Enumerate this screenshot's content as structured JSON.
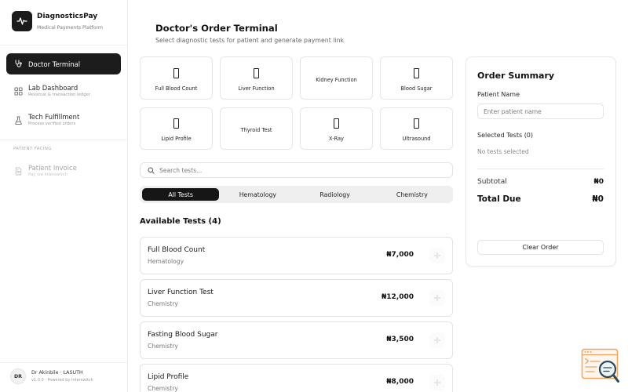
{
  "app": {
    "name": "DiagnosticsPay",
    "tagline": "Medical Payments Platform",
    "logo_icon": "pulse-icon"
  },
  "sidebar": {
    "items": [
      {
        "label": "Doctor Terminal",
        "icon": "stethoscope-icon",
        "active": true
      },
      {
        "label": "Lab Dashboard",
        "subtitle": "Revenue & transaction ledger",
        "icon": "grid-icon",
        "active": false
      },
      {
        "label": "Tech Fulfillment",
        "subtitle": "Process verified orders",
        "icon": "flask-icon",
        "active": false
      }
    ],
    "section_label": "PATIENT FACING",
    "patient_items": [
      {
        "label": "Patient Invoice",
        "subtitle": "Pay via Interswitch",
        "icon": "document-icon",
        "disabled": true
      }
    ],
    "user": {
      "initials": "DR",
      "name": "Dr Akinbile · LASUTH",
      "version": "v1.0.0 · Powered by Interswitch"
    }
  },
  "page": {
    "title": "Doctor's Order Terminal",
    "subtitle": "Select diagnostic tests for patient and generate payment link"
  },
  "quick_tests": [
    {
      "label": "Full Blood Count",
      "has_icon": true
    },
    {
      "label": "Liver Function",
      "has_icon": true
    },
    {
      "label": "Kidney Function",
      "has_icon": false
    },
    {
      "label": "Blood Sugar",
      "has_icon": true
    },
    {
      "label": "Lipid Profile",
      "has_icon": true
    },
    {
      "label": "Thyroid Test",
      "has_icon": false
    },
    {
      "label": "X-Ray",
      "has_icon": true
    },
    {
      "label": "Ultrasound",
      "has_icon": true
    }
  ],
  "search": {
    "placeholder": "Search tests...",
    "value": "",
    "icon": "search-icon"
  },
  "filters": {
    "tabs": [
      "All Tests",
      "Hematology",
      "Radiology",
      "Chemistry"
    ],
    "active_index": 0
  },
  "available": {
    "heading": "Available Tests (4)",
    "tests": [
      {
        "name": "Full Blood Count",
        "category": "Hematology",
        "price": "₦7,000"
      },
      {
        "name": "Liver Function Test",
        "category": "Chemistry",
        "price": "₦12,000"
      },
      {
        "name": "Fasting Blood Sugar",
        "category": "Chemistry",
        "price": "₦3,500"
      },
      {
        "name": "Lipid Profile",
        "category": "Chemistry",
        "price": "₦8,000"
      }
    ]
  },
  "order_summary": {
    "title": "Order Summary",
    "patient_label": "Patient Name",
    "patient_placeholder": "Enter patient name",
    "patient_value": "",
    "selected_label": "Selected Tests (0)",
    "empty_text": "No tests selected",
    "subtotal_label": "Subtotal",
    "subtotal_value": "₦0",
    "total_label": "Total Due",
    "total_value": "₦0",
    "clear_label": "Clear Order"
  },
  "floating_widget": {
    "icon": "web-search-icon"
  },
  "colors": {
    "primary": "#1c1c1c",
    "border": "#e6e6e6",
    "muted_text": "#777777",
    "segment_bg": "#efefef",
    "widget_orange": "#f0a25b",
    "widget_teal": "#2c4a57"
  }
}
